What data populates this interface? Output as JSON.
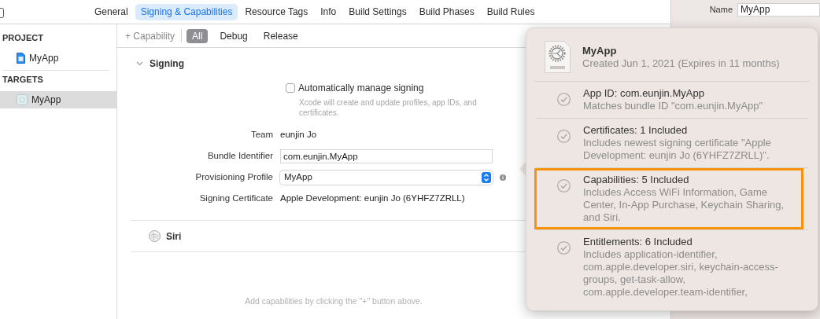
{
  "tabs": [
    {
      "label": "General",
      "selected": false
    },
    {
      "label": "Signing & Capabilities",
      "selected": true
    },
    {
      "label": "Resource Tags",
      "selected": false
    },
    {
      "label": "Info",
      "selected": false
    },
    {
      "label": "Build Settings",
      "selected": false
    },
    {
      "label": "Build Phases",
      "selected": false
    },
    {
      "label": "Build Rules",
      "selected": false
    }
  ],
  "sidebar": {
    "sections": [
      {
        "heading": "PROJECT",
        "items": [
          {
            "label": "MyApp",
            "kind": "project",
            "selected": false
          }
        ]
      },
      {
        "heading": "TARGETS",
        "items": [
          {
            "label": "MyApp",
            "kind": "target",
            "selected": true
          }
        ]
      }
    ]
  },
  "toolbar": {
    "add_capability": "+ Capability",
    "filters": [
      {
        "label": "All",
        "selected": true
      },
      {
        "label": "Debug",
        "selected": false
      },
      {
        "label": "Release",
        "selected": false
      }
    ]
  },
  "signing": {
    "title": "Signing",
    "expanded": true,
    "auto_manage": {
      "label": "Automatically manage signing",
      "checked": false,
      "hint": "Xcode will create and update profiles, app IDs, and certificates."
    },
    "fields": [
      {
        "label": "Team",
        "kind": "text",
        "value": "eunjin Jo"
      },
      {
        "label": "Bundle Identifier",
        "kind": "input",
        "value": "com.eunjin.MyApp"
      },
      {
        "label": "Provisioning Profile",
        "kind": "popup",
        "value": "MyApp"
      },
      {
        "label": "Signing Certificate",
        "kind": "text",
        "value": "Apple Development: eunjin Jo (6YHFZ7ZRLL)"
      }
    ]
  },
  "siri": {
    "title": "Siri"
  },
  "empty_hint": "Add capabilities by clicking the \"+\" button above.",
  "inspector": {
    "name_label": "Name",
    "name_value": "MyApp"
  },
  "popover": {
    "title": "MyApp",
    "subtitle": "Created Jun 1, 2021 (Expires in 11 months)",
    "items": [
      {
        "title": "App ID: com.eunjin.MyApp",
        "description": "Matches bundle ID \"com.eunjin.MyApp\"",
        "highlighted": false
      },
      {
        "title": "Certificates: 1 Included",
        "description": "Includes newest signing certificate \"Apple Development: eunjin Jo (6YHFZ7ZRLL)\".",
        "highlighted": false
      },
      {
        "title": "Capabilities: 5 Included",
        "description": "Includes Access WiFi Information, Game Center, In-App Purchase, Keychain Sharing, and Siri.",
        "highlighted": true
      },
      {
        "title": "Entitlements: 6 Included",
        "description": "Includes application-identifier, com.apple.developer.siri, keychain-access-groups, get-task-allow, com.apple.developer.team-identifier,",
        "highlighted": false
      }
    ]
  }
}
